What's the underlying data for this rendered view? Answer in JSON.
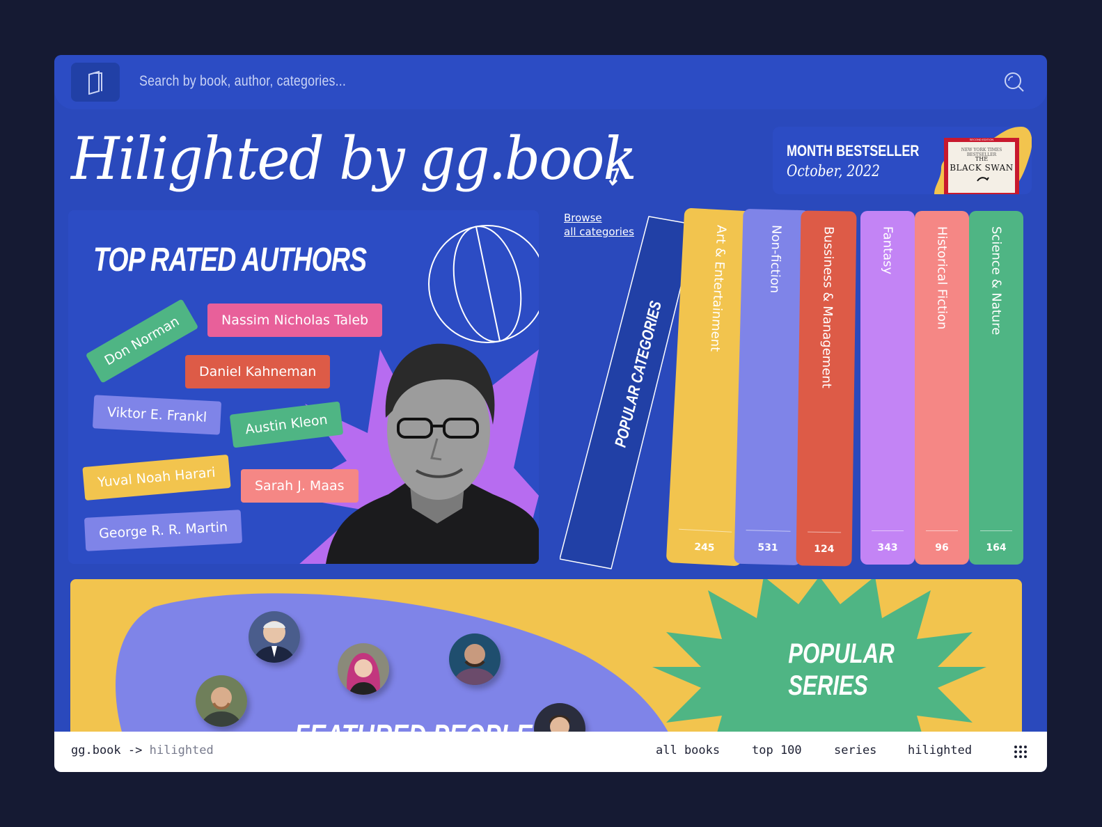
{
  "search": {
    "placeholder": "Search by book, author, categories..."
  },
  "hero": {
    "title": "Hilighted by gg.book"
  },
  "bestseller": {
    "label": "MONTH BESTSELLER",
    "date": "October, 2022",
    "cover_title": "BLACK SWAN",
    "cover_the": "THE",
    "cover_blurb": "NEW YORK TIMES BESTSELLER",
    "cover_edition": "SECOND EDITION"
  },
  "authors": {
    "title": "TOP RATED AUTHORS",
    "chips": [
      {
        "name": "Don Norman",
        "color": "#4fb584"
      },
      {
        "name": "Nassim Nicholas Taleb",
        "color": "#e8609a"
      },
      {
        "name": "Daniel Kahneman",
        "color": "#dd5b47"
      },
      {
        "name": "Viktor E. Frankl",
        "color": "#7f84e8"
      },
      {
        "name": "Austin Kleon",
        "color": "#4fb584"
      },
      {
        "name": "Yuval Noah Harari",
        "color": "#f2c44e"
      },
      {
        "name": "Sarah J. Maas",
        "color": "#f58785"
      },
      {
        "name": "George R. R. Martin",
        "color": "#7f84e8"
      }
    ]
  },
  "categories": {
    "browse_line1": "Browse",
    "browse_line2": "all categories",
    "heading": "POPULAR CATEGORIES",
    "books": [
      {
        "label": "Art & Entertainment",
        "count": "245",
        "color": "#f2c44e"
      },
      {
        "label": "Non-fiction",
        "count": "531",
        "color": "#7f84e8"
      },
      {
        "label": "Bussiness & Management",
        "count": "124",
        "color": "#dd5b47"
      },
      {
        "label": "Fantasy",
        "count": "343",
        "color": "#c384f5"
      },
      {
        "label": "Historical Fiction",
        "count": "96",
        "color": "#f58785"
      },
      {
        "label": "Science & Nature",
        "count": "164",
        "color": "#4fb584"
      }
    ]
  },
  "featured": {
    "title": "FEATURED PEOPLE",
    "series_line1": "POPULAR",
    "series_line2": "SERIES"
  },
  "footer": {
    "crumb_root": "gg.book",
    "crumb_sep": "->",
    "crumb_current": "hilighted",
    "links": [
      "all books",
      "top 100",
      "series",
      "hilighted"
    ]
  },
  "colors": {
    "page_bg": "#151a33",
    "app_bg": "#2a49bc",
    "panel_bg": "#2c4cc4",
    "yellow": "#f2c44e",
    "green": "#4fb584",
    "purple": "#7f84e8"
  }
}
